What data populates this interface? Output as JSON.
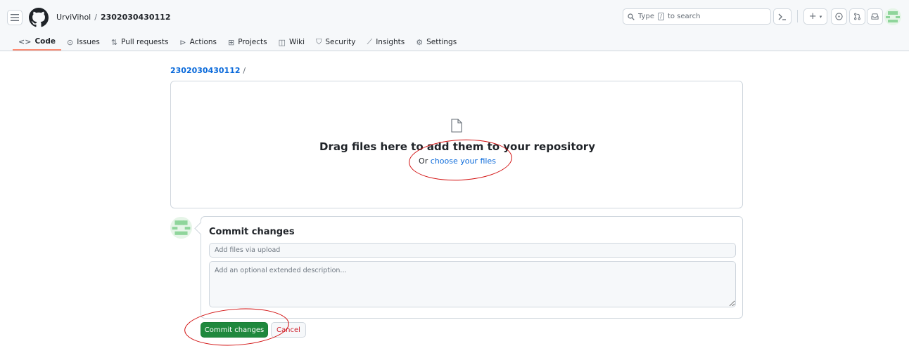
{
  "header": {
    "owner": "UrviVihol",
    "separator": "/",
    "repo": "2302030430112",
    "search_prefix": "Type",
    "search_key": "/",
    "search_suffix": "to search",
    "command_palette_icon": "terminal-icon",
    "create_new_icon": "plus-icon",
    "issues_icon": "issue-opened-icon",
    "pulls_icon": "git-pull-request-icon",
    "inbox_icon": "inbox-icon"
  },
  "nav": {
    "items": [
      {
        "label": "Code",
        "icon": "code-icon",
        "active": true
      },
      {
        "label": "Issues",
        "icon": "issue-opened-icon"
      },
      {
        "label": "Pull requests",
        "icon": "git-pull-request-icon"
      },
      {
        "label": "Actions",
        "icon": "play-icon"
      },
      {
        "label": "Projects",
        "icon": "table-icon"
      },
      {
        "label": "Wiki",
        "icon": "book-icon"
      },
      {
        "label": "Security",
        "icon": "shield-icon"
      },
      {
        "label": "Insights",
        "icon": "graph-icon"
      },
      {
        "label": "Settings",
        "icon": "gear-icon"
      }
    ]
  },
  "breadcrumb": {
    "repo": "2302030430112",
    "slash": "/"
  },
  "upload": {
    "title": "Drag files here to add them to your repository",
    "or_text": "Or",
    "choose_link": "choose your files"
  },
  "commit": {
    "title": "Commit changes",
    "message_placeholder": "Add files via upload",
    "description_placeholder": "Add an optional extended description...",
    "commit_button": "Commit changes",
    "cancel_button": "Cancel"
  },
  "colors": {
    "primary_button": "#1f883d",
    "link": "#0969da",
    "annotation": "#d20f0f",
    "active_tab_underline": "#fd8c73",
    "cancel_text": "#cf222e"
  }
}
